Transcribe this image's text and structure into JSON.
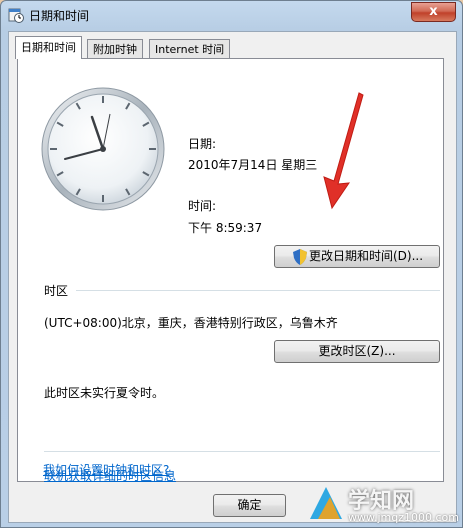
{
  "window": {
    "title": "日期和时间",
    "close_label": "x"
  },
  "tabs": [
    {
      "label": "日期和时间",
      "active": true
    },
    {
      "label": "附加时钟",
      "active": false
    },
    {
      "label": "Internet 时间",
      "active": false
    }
  ],
  "datetime": {
    "date_label": "日期:",
    "date_value": "2010年7月14日 星期三",
    "time_label": "时间:",
    "time_value": "下午 8:59:37",
    "change_button": "更改日期和时间(D)..."
  },
  "timezone": {
    "section_label": "时区",
    "value": "(UTC+08:00)北京，重庆，香港特别行政区，乌鲁木齐",
    "change_button": "更改时区(Z)...",
    "dst_note": "此时区未实行夏令时。"
  },
  "links": {
    "online_info": "联机获取详细的时区信息",
    "how_to": "我如何设置时钟和时区?"
  },
  "footer": {
    "ok_label": "确定"
  },
  "watermark": {
    "site_name": "学知网",
    "site_url": "www.jmqz1000.com"
  },
  "colors": {
    "link": "#0066cc",
    "annotation_arrow": "#e03028",
    "close_button": "#c0412a"
  }
}
